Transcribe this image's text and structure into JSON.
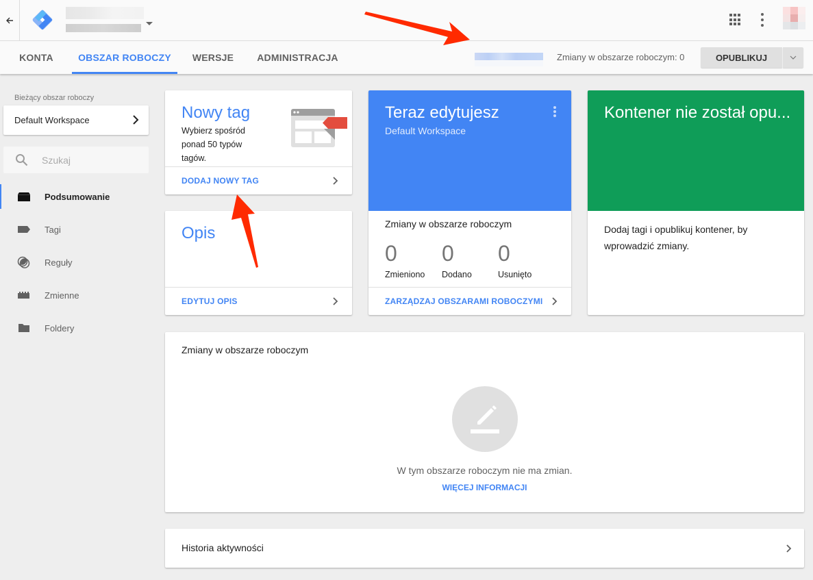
{
  "header": {
    "back_icon": "arrow-left-icon",
    "logo": "gtm-logo-icon",
    "container_name": "[redacted container name]",
    "apps_icon": "apps-grid-icon",
    "more_icon": "more-vertical-icon",
    "avatar": "[redacted avatar]"
  },
  "tabs": [
    {
      "label": "KONTA",
      "active": false
    },
    {
      "label": "OBSZAR ROBOCZY",
      "active": true
    },
    {
      "label": "WERSJE",
      "active": false
    },
    {
      "label": "ADMINISTRACJA",
      "active": false
    }
  ],
  "toolbar": {
    "workspace_id": "[redacted workspace id]",
    "changes_label": "Zmiany w obszarze roboczym: 0",
    "publish_label": "OPUBLIKUJ",
    "publish_dropdown_icon": "chevron-down-icon"
  },
  "sidebar": {
    "caption": "Bieżący obszar roboczy",
    "workspace": "Default Workspace",
    "search_placeholder": "Szukaj",
    "items": [
      {
        "label": "Podsumowanie",
        "icon": "briefcase-icon",
        "active": true
      },
      {
        "label": "Tagi",
        "icon": "tag-icon",
        "active": false
      },
      {
        "label": "Reguły",
        "icon": "trigger-icon",
        "active": false
      },
      {
        "label": "Zmienne",
        "icon": "variable-block-icon",
        "active": false
      },
      {
        "label": "Foldery",
        "icon": "folder-icon",
        "active": false
      }
    ]
  },
  "cards": {
    "new_tag": {
      "title": "Nowy tag",
      "description": "Wybierz spośród ponad 50 typów tagów.",
      "action": "DODAJ NOWY TAG"
    },
    "description": {
      "title": "Opis",
      "action": "EDYTUJ OPIS"
    },
    "editing": {
      "title": "Teraz edytujesz",
      "workspace": "Default Workspace",
      "changes_title": "Zmiany w obszarze roboczym",
      "stats": [
        {
          "value": "0",
          "label": "Zmieniono"
        },
        {
          "value": "0",
          "label": "Dodano"
        },
        {
          "value": "0",
          "label": "Usunięto"
        }
      ],
      "action": "ZARZĄDZAJ OBSZARAMI ROBOCZYMI",
      "color": "#4285f4"
    },
    "published": {
      "title": "Kontener nie został opu...",
      "body": "Dodaj tagi i opublikuj kontener, by wprowadzić zmiany.",
      "color": "#0f9d58"
    },
    "workspace_changes": {
      "title": "Zmiany w obszarze roboczym",
      "empty_icon": "edit-pencil-icon",
      "empty_text": "W tym obszarze roboczym nie ma zmian.",
      "more_link": "WIĘCEJ INFORMACJI"
    },
    "activity_history": {
      "title": "Historia aktywności"
    }
  },
  "colors": {
    "accent": "#4285f4",
    "success": "#0f9d58",
    "annotation": "#ff2a00"
  }
}
